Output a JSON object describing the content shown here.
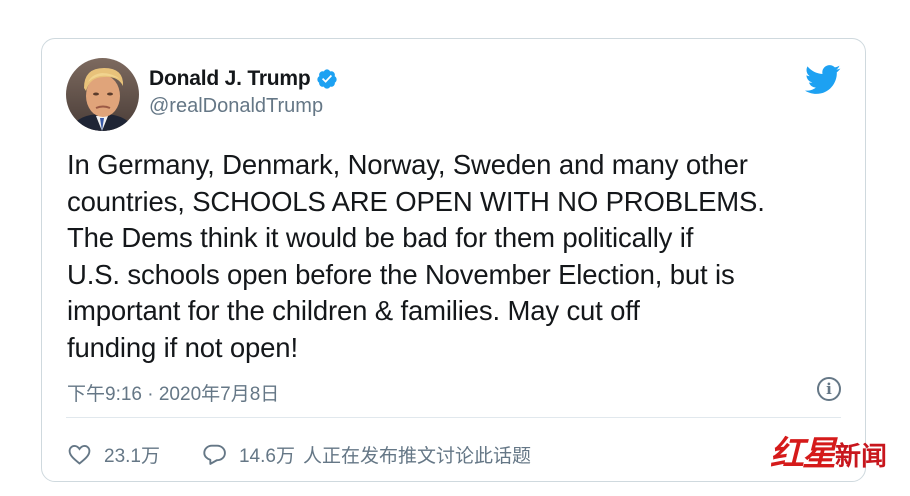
{
  "tweet": {
    "author": {
      "display_name": "Donald J. Trump",
      "handle": "@realDonaldTrump",
      "verified": true
    },
    "text": "In Germany, Denmark, Norway,  Sweden and many other\ncountries, SCHOOLS ARE OPEN WITH NO PROBLEMS.\nThe Dems think it would be bad for them politically if\nU.S. schools open before the November Election, but is\nimportant for the children & families. May cut off\nfunding if not open!",
    "timestamp": "下午9:16 · 2020年7月8日",
    "info_glyph": "i",
    "likes": "23.1万",
    "replies": "14.6万",
    "talk_label": "人正在发布推文讨论此话题"
  },
  "watermark": {
    "brand": "红星",
    "suffix": "新闻"
  },
  "icons": {
    "brand": "twitter-bird-icon",
    "verified": "verified-badge-icon",
    "like": "heart-icon",
    "reply": "speech-bubble-icon",
    "info": "info-icon"
  },
  "colors": {
    "twitter_blue": "#1da1f2",
    "secondary_text": "#657786",
    "primary_text": "#14171a",
    "border": "#cfd9de",
    "watermark_red": "#d51a1a"
  }
}
